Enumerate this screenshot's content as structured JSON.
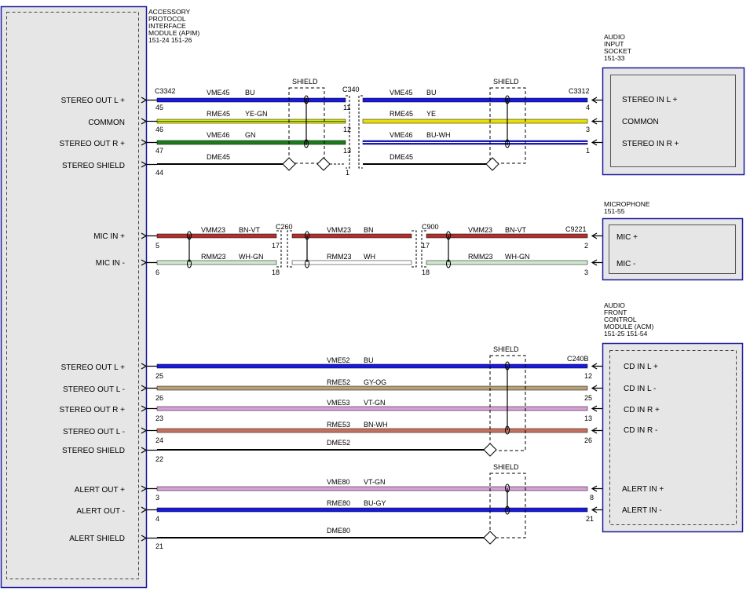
{
  "modules": {
    "apim": {
      "title": [
        "ACCESSORY",
        "PROTOCOL",
        "INTERFACE",
        "MODULE (APIM)",
        "151-24  151-26"
      ]
    },
    "audio_input_socket": {
      "title": [
        "AUDIO",
        "INPUT",
        "SOCKET",
        "151-33"
      ]
    },
    "microphone": {
      "title": [
        "MICROPHONE",
        "151-55"
      ]
    },
    "acm": {
      "title": [
        "AUDIO",
        "FRONT",
        "CONTROL",
        "MODULE (ACM)",
        "151-25  151-54"
      ]
    }
  },
  "shield_label": "SHIELD",
  "connectors": {
    "c3342": "C3342",
    "c340": "C340",
    "c3312": "C3312",
    "c260": "C260",
    "c900": "C900",
    "c9221": "C9221",
    "c240b": "C240B"
  },
  "apim_pins": [
    {
      "label": "STEREO OUT L +",
      "pin": "45"
    },
    {
      "label": "COMMON",
      "pin": "46"
    },
    {
      "label": "STEREO OUT R +",
      "pin": "47"
    },
    {
      "label": "STEREO SHIELD",
      "pin": "44"
    },
    {
      "label": "MIC IN +",
      "pin": "5"
    },
    {
      "label": "MIC IN -",
      "pin": "6"
    },
    {
      "label": "STEREO OUT L +",
      "pin": "25"
    },
    {
      "label": "STEREO OUT L -",
      "pin": "26"
    },
    {
      "label": "STEREO OUT R +",
      "pin": "23"
    },
    {
      "label": "STEREO OUT L -",
      "pin": "24"
    },
    {
      "label": "STEREO SHIELD",
      "pin": "22"
    },
    {
      "label": "ALERT OUT +",
      "pin": "3"
    },
    {
      "label": "ALERT OUT -",
      "pin": "4"
    },
    {
      "label": "ALERT SHIELD",
      "pin": "21"
    }
  ],
  "socket_pins": [
    {
      "label": "STEREO IN L +",
      "pin": "4"
    },
    {
      "label": "COMMON",
      "pin": "3"
    },
    {
      "label": "STEREO IN R +",
      "pin": "1"
    }
  ],
  "mic_pins": [
    {
      "label": "MIC +",
      "pin": "2"
    },
    {
      "label": "MIC -",
      "pin": "3"
    }
  ],
  "acm_pins": [
    {
      "label": "CD IN L +",
      "pin": "12"
    },
    {
      "label": "CD IN L -",
      "pin": "25"
    },
    {
      "label": "CD IN R +",
      "pin": "13"
    },
    {
      "label": "CD IN R -",
      "pin": "26"
    },
    {
      "label": "ALERT IN +",
      "pin": "8"
    },
    {
      "label": "ALERT IN -",
      "pin": "21"
    }
  ],
  "mid_pins": {
    "c340": [
      "11",
      "12",
      "13",
      "1"
    ],
    "c260": [
      "17",
      "18"
    ],
    "c900": [
      "17",
      "18"
    ]
  },
  "wires": {
    "stereo_in_left": [
      {
        "circuit": "VME45",
        "color": "BU"
      },
      {
        "circuit": "RME45",
        "color": "YE-GN"
      },
      {
        "circuit": "VME46",
        "color": "GN"
      },
      {
        "circuit": "DME45",
        "color": ""
      }
    ],
    "stereo_in_right": [
      {
        "circuit": "VME45",
        "color": "BU"
      },
      {
        "circuit": "RME45",
        "color": "YE"
      },
      {
        "circuit": "VME46",
        "color": "BU-WH"
      },
      {
        "circuit": "DME45",
        "color": ""
      }
    ],
    "mic_a": [
      {
        "circuit": "VMM23",
        "color": "BN-VT"
      },
      {
        "circuit": "RMM23",
        "color": "WH-GN"
      }
    ],
    "mic_b": [
      {
        "circuit": "VMM23",
        "color": "BN"
      },
      {
        "circuit": "RMM23",
        "color": "WH"
      }
    ],
    "mic_c": [
      {
        "circuit": "VMM23",
        "color": "BN-VT"
      },
      {
        "circuit": "RMM23",
        "color": "WH-GN"
      }
    ],
    "acm": [
      {
        "circuit": "VME52",
        "color": "BU"
      },
      {
        "circuit": "RME52",
        "color": "GY-OG"
      },
      {
        "circuit": "VME53",
        "color": "VT-GN"
      },
      {
        "circuit": "RME53",
        "color": "BN-WH"
      },
      {
        "circuit": "DME52",
        "color": ""
      },
      {
        "circuit": "VME80",
        "color": "VT-GN"
      },
      {
        "circuit": "RME80",
        "color": "BU-GY"
      },
      {
        "circuit": "DME80",
        "color": ""
      }
    ]
  },
  "wire_colors": {
    "blue": "#1a1adc",
    "yellow": "#e8e000",
    "green": "#1b7d1b",
    "black": "#000000",
    "brown_red": "#b03030",
    "white_green": "#cfe8cf",
    "white": "#ffffff",
    "tan": "#b8a078",
    "violet": "#d8a0d8",
    "brown_white": "#c87060",
    "module_border": "#1a1a9c"
  }
}
